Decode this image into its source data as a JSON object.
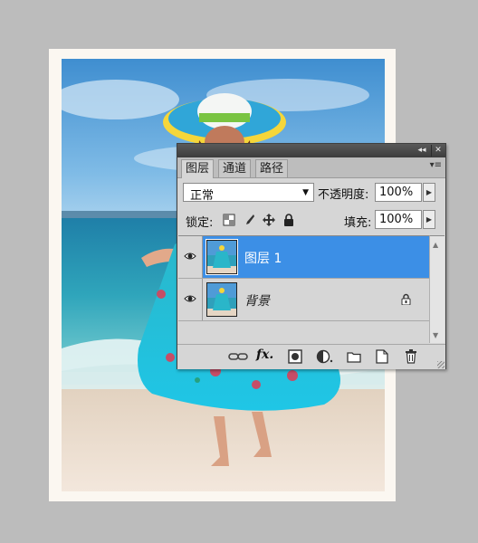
{
  "panel": {
    "tabs": [
      "图层",
      "通道",
      "路径"
    ],
    "active_tab": "图层",
    "blend_mode": "正常",
    "opacity_label": "不透明度:",
    "opacity_value": "100%",
    "lock_label": "锁定:",
    "fill_label": "填充:",
    "fill_value": "100%",
    "layers": [
      {
        "name": "图层 1",
        "selected": true,
        "visible": true
      },
      {
        "name": "背景",
        "selected": false,
        "visible": true,
        "locked": true
      }
    ]
  },
  "icons": {
    "titlebar": [
      "collapse-icon",
      "close-icon"
    ],
    "panel_menu": "panel-menu-icon",
    "lock": [
      "lock-transparent-icon",
      "lock-pixels-icon",
      "lock-position-icon",
      "lock-all-icon"
    ],
    "bottom": [
      "link-icon",
      "fx-icon",
      "mask-icon",
      "adjustment-icon",
      "folder-icon",
      "new-layer-icon",
      "trash-icon"
    ]
  },
  "colors": {
    "selected_layer": "#3c8fe6",
    "panel_bg": "#d6d6d6",
    "canvas_bg": "#bcbcbc"
  }
}
